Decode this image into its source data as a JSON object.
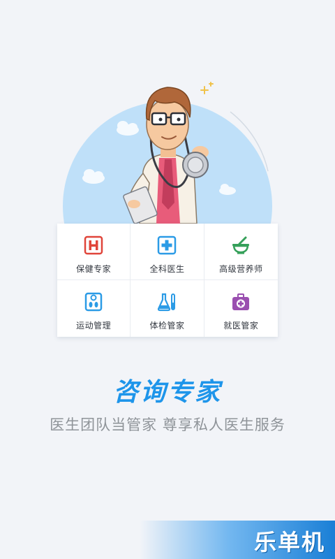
{
  "services": [
    {
      "label": "保健专家",
      "icon": "hospital-h-icon",
      "color": "#e0453a"
    },
    {
      "label": "全科医生",
      "icon": "medical-cross-icon",
      "color": "#2b9be6"
    },
    {
      "label": "高级营养师",
      "icon": "mortar-pestle-icon",
      "color": "#36a05a"
    },
    {
      "label": "运动管理",
      "icon": "scale-footprints-icon",
      "color": "#2b9be6"
    },
    {
      "label": "体检管家",
      "icon": "lab-flask-icon",
      "color": "#2b9be6"
    },
    {
      "label": "就医管家",
      "icon": "medical-kit-icon",
      "color": "#9a4fb0"
    }
  ],
  "headline": "咨询专家",
  "tagline": "医生团队当管家   尊享私人医生服务",
  "watermark": "乐单机",
  "colors": {
    "accent": "#1e95ea",
    "background": "#f2f4f8",
    "circle": "#bfe0f9"
  }
}
